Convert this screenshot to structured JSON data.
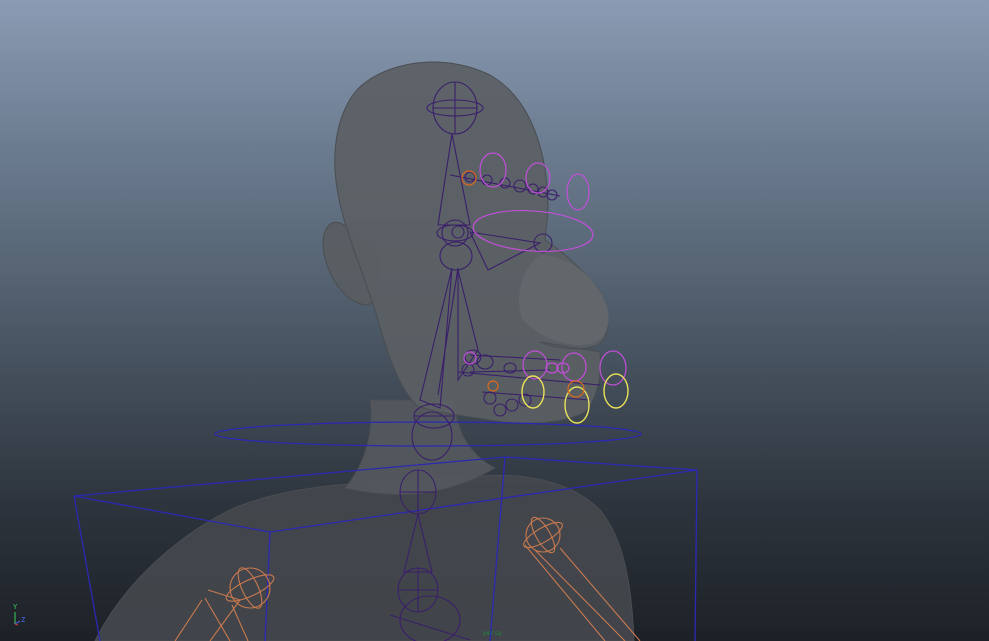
{
  "viewport": {
    "camera_label": "persp",
    "background": {
      "top": "#8a9bb3",
      "bottom": "#1d2127"
    }
  },
  "axes": {
    "y_label": "Y",
    "z_label": "Z",
    "colors": {
      "x": "#d23a3a",
      "y": "#3ccf5a",
      "z": "#4a6cff"
    }
  },
  "colors": {
    "mesh": "#5a5e63",
    "joint": "#3a1f6a",
    "face_control": "#c14fd8",
    "selected_control": "#e8e15a",
    "body_control": "#2c28b4",
    "arm_joint": "#c8794f",
    "eyebrow_joint": "#d86a20"
  }
}
